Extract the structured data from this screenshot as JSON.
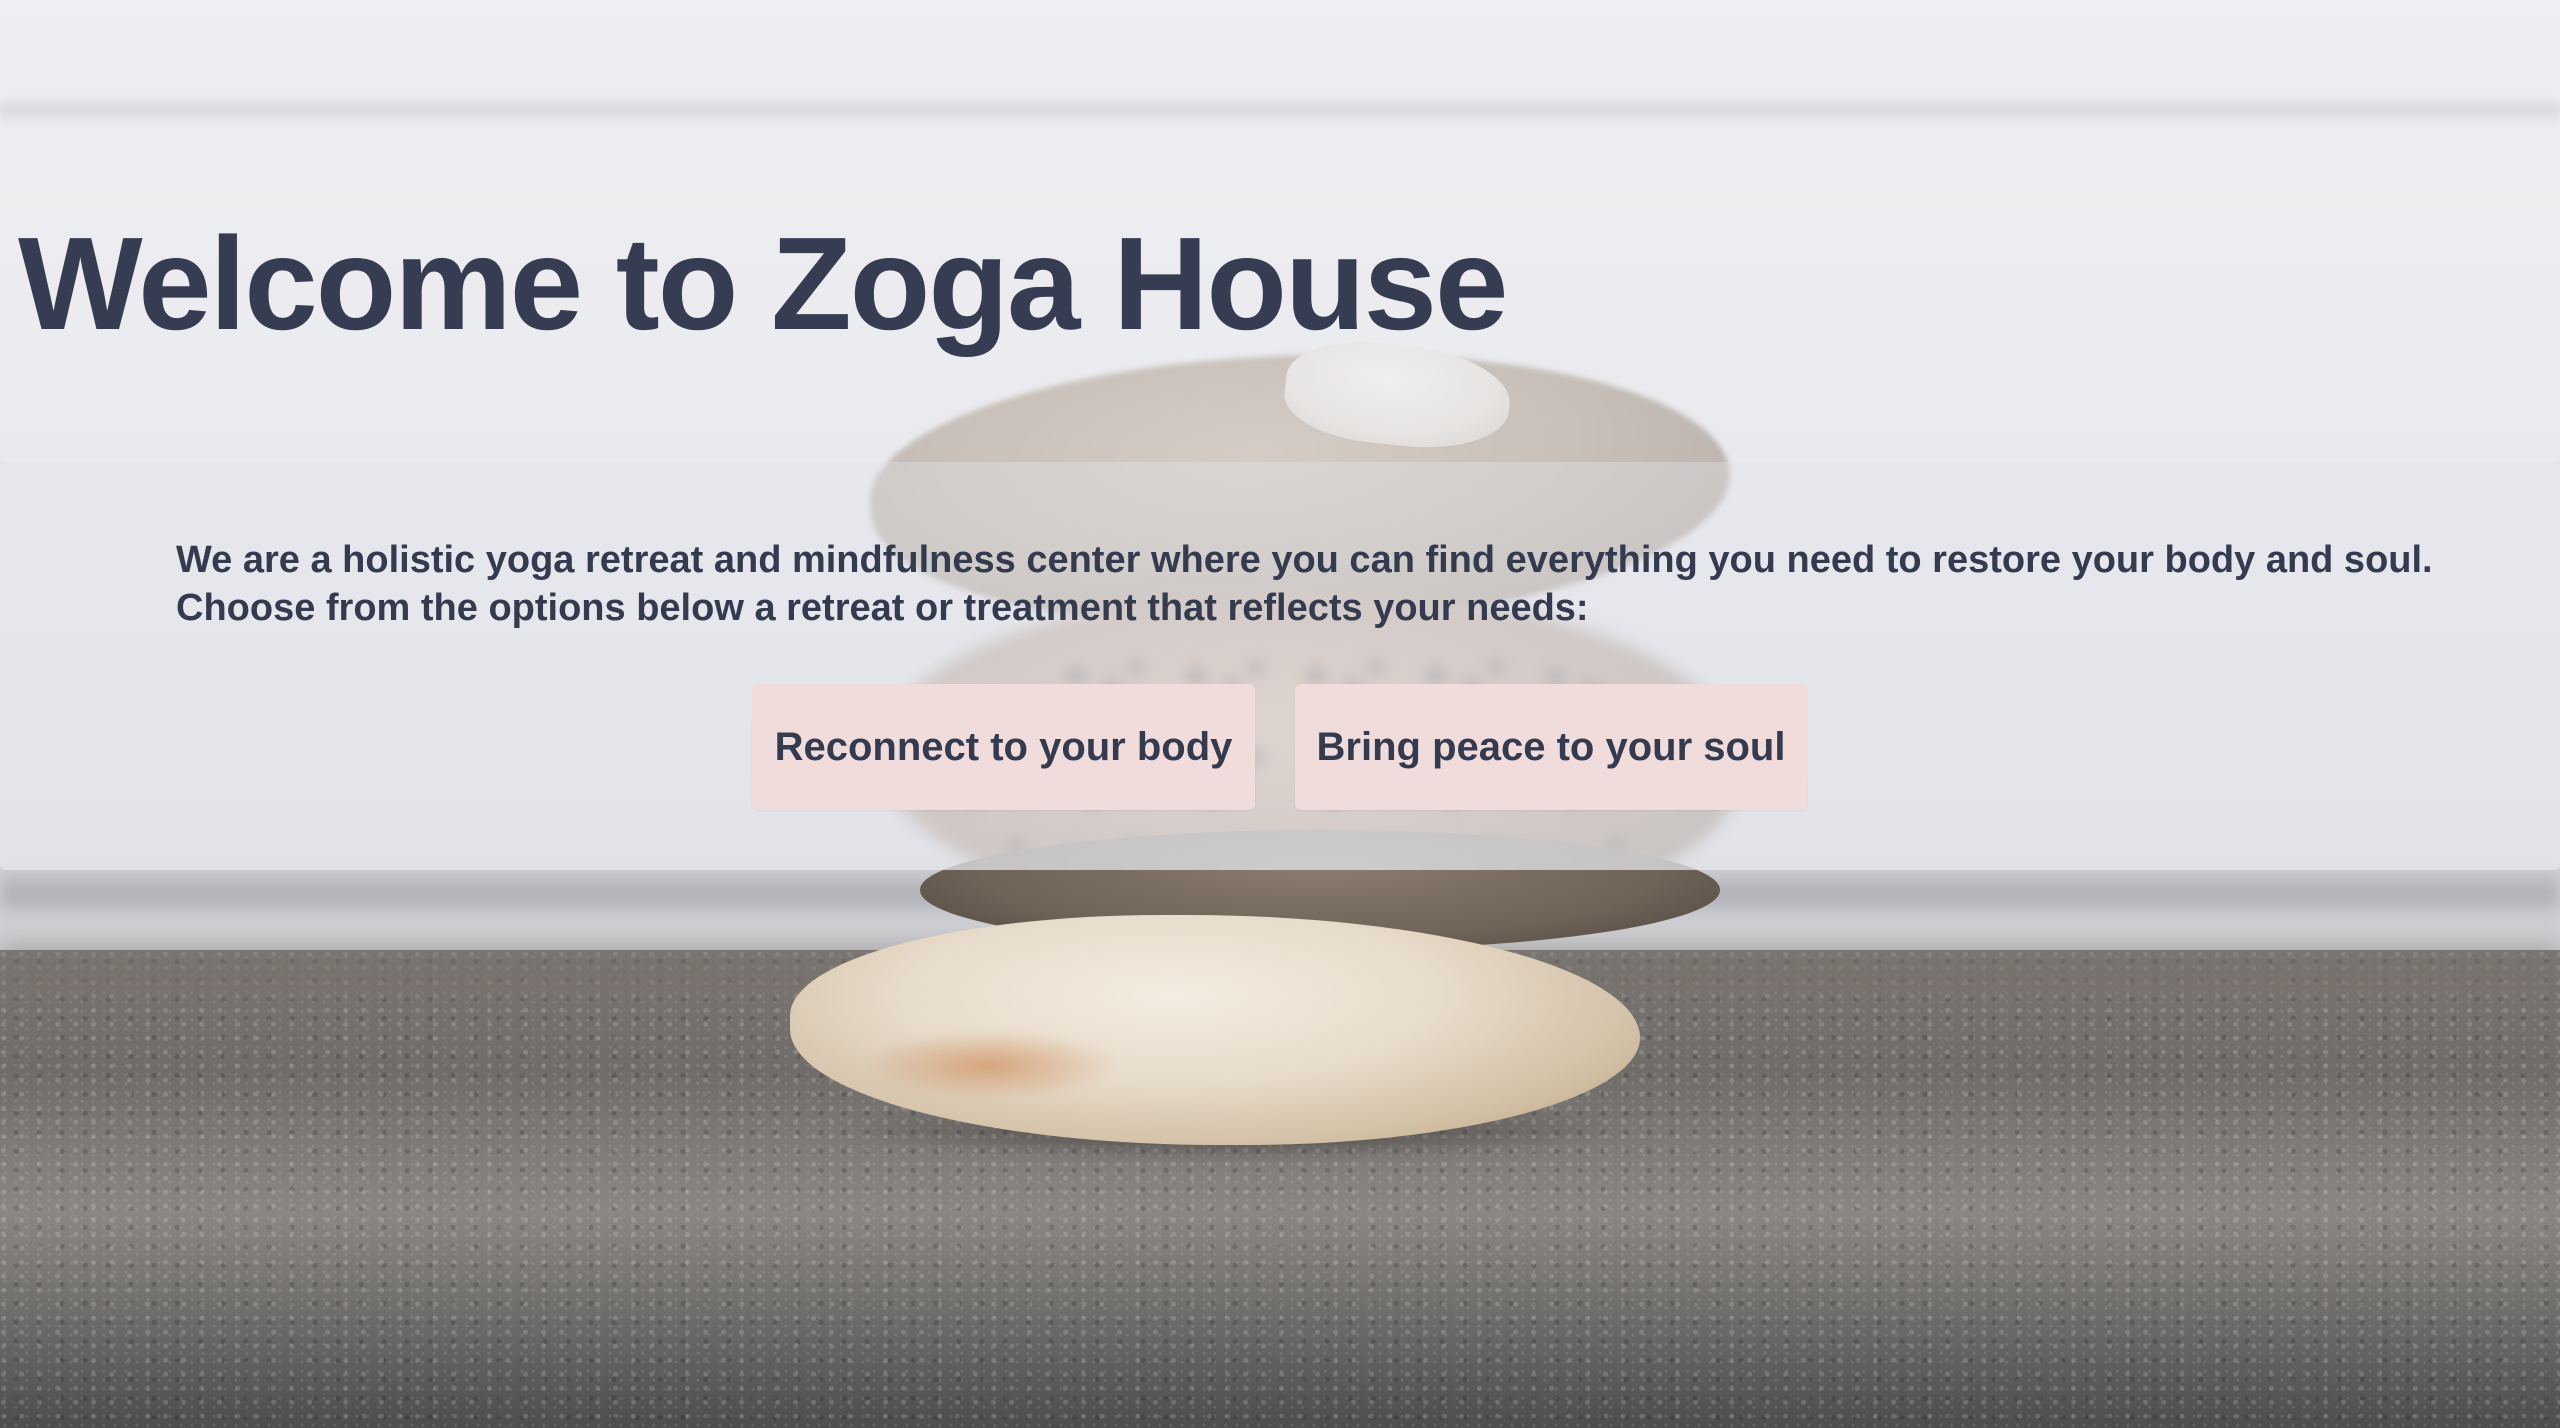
{
  "hero": {
    "title": "Welcome to Zoga House"
  },
  "intro": {
    "line1": "We are a holistic yoga retreat and mindfulness center where you can find everything you need to restore your body and soul.",
    "line2": "Choose from the options below a retreat or treatment that reflects your needs:"
  },
  "options": {
    "body_button": "Reconnect to your body",
    "soul_button": "Bring peace to your soul"
  },
  "colors": {
    "text": "#363d52",
    "button_bg": "#f1dcdc"
  }
}
